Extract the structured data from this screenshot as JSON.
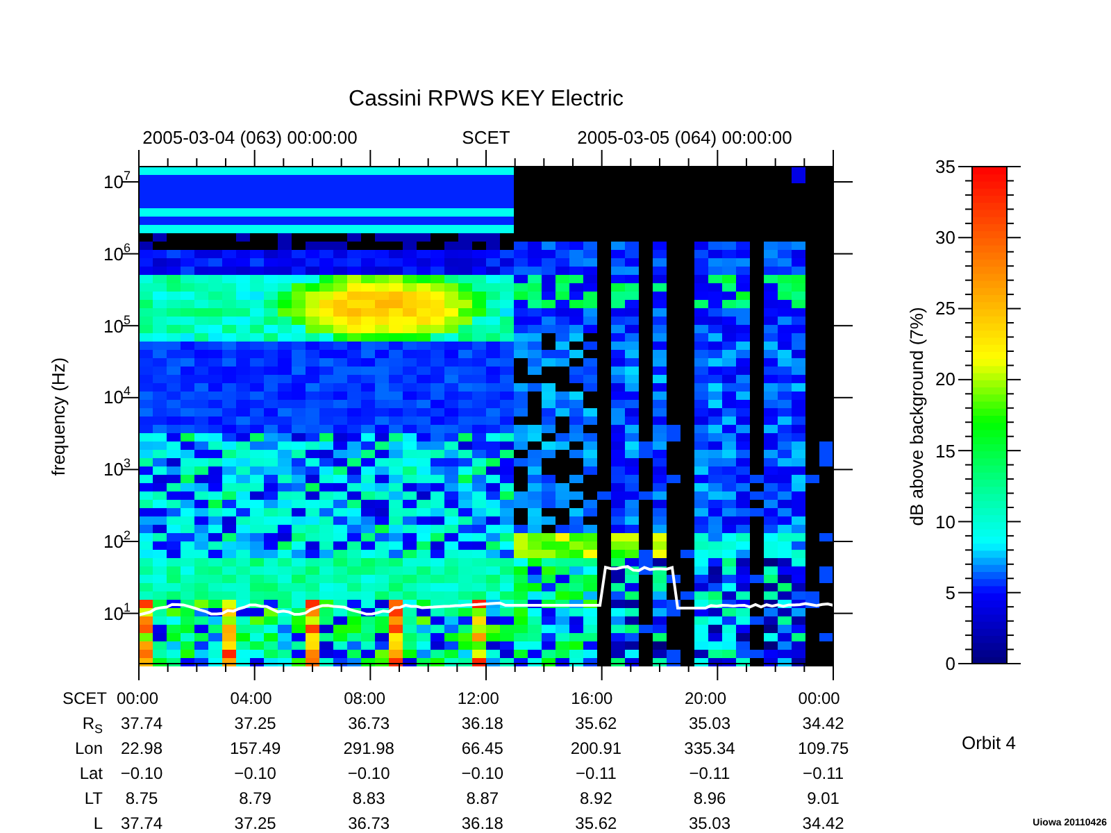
{
  "title": "Cassini RPWS KEY Electric",
  "top_axis": {
    "labels": [
      "2005-03-04 (063) 00:00:00",
      "SCET",
      "2005-03-05 (064) 00:00:00"
    ]
  },
  "y_axis": {
    "label": "frequency (Hz)",
    "ticks": [
      "10$^{7}$",
      "10$^{6}$",
      "10$^{5}$",
      "10$^{4}$",
      "10$^{3}$",
      "10$^{2}$",
      "10$^{1}$"
    ]
  },
  "colorbar": {
    "label": "dB above background (7%)",
    "ticks": [
      "35",
      "30",
      "25",
      "20",
      "15",
      "10",
      "5",
      "0"
    ]
  },
  "ephemeris": [
    {
      "label": "SCET",
      "values": [
        "00:00",
        "04:00",
        "08:00",
        "12:00",
        "16:00",
        "20:00",
        "00:00"
      ]
    },
    {
      "label": "R$_{S}$",
      "values": [
        "37.74",
        "37.25",
        "36.73",
        "36.18",
        "35.62",
        "35.03",
        "34.42"
      ]
    },
    {
      "label": "Lon",
      "values": [
        "22.98",
        "157.49",
        "291.98",
        "66.45",
        "200.91",
        "335.34",
        "109.75"
      ]
    },
    {
      "label": "Lat",
      "values": [
        "−0.10",
        "−0.10",
        "−0.10",
        "−0.10",
        "−0.11",
        "−0.11",
        "−0.11"
      ]
    },
    {
      "label": "LT",
      "values": [
        "8.75",
        "8.79",
        "8.83",
        "8.87",
        "8.92",
        "8.96",
        "9.01"
      ]
    },
    {
      "label": "L",
      "values": [
        "37.74",
        "37.25",
        "36.73",
        "36.18",
        "35.62",
        "35.03",
        "34.42"
      ]
    }
  ],
  "orbit": "Orbit 4",
  "credit": "Uiowa 20110426"
}
